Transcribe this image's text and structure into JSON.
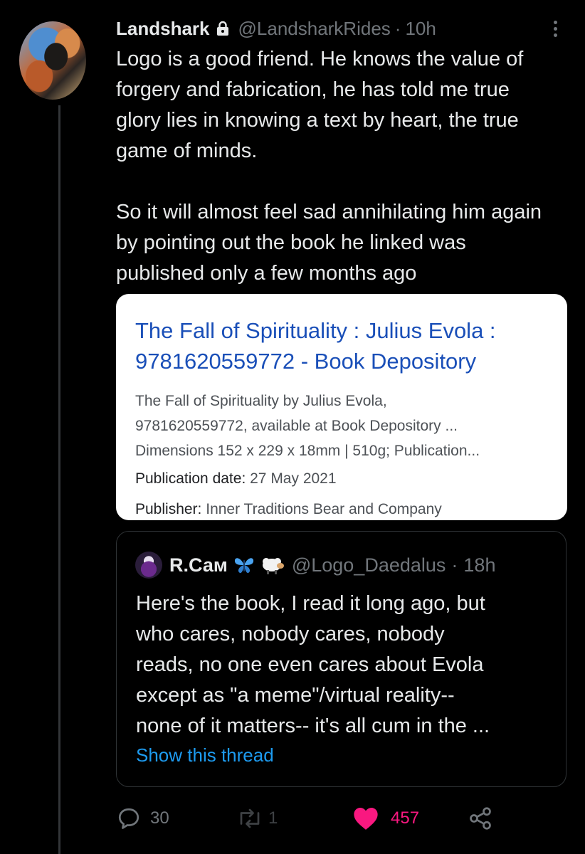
{
  "tweet": {
    "author_name": "Landshark",
    "author_handle": "@LandsharkRides",
    "separator": "·",
    "time": "10h",
    "paragraphs": [
      "Logo is a good friend. He knows the value of forgery and fabrication, he has told me true glory lies in knowing a text by heart, the true game of minds.",
      "So it will almost feel sad annihilating him again by pointing out the book he linked was published only a few months ago"
    ]
  },
  "link_card": {
    "title_line1": "The Fall of Spirituality : Julius Evola :",
    "title_line2": "9781620559772 - Book Depository",
    "snippet_line1": "The Fall of Spirituality by Julius Evola,",
    "snippet_line2": "9781620559772, available at Book Depository ...",
    "snippet_line3": "Dimensions 152 x 229 x 18mm | 510g; Publication...",
    "pub_date_label": "Publication date:",
    "pub_date_value": "27 May 2021",
    "publisher_label": "Publisher:",
    "publisher_value": "Inner Traditions Bear and Company"
  },
  "quoted_tweet": {
    "author_name": "R.Сам",
    "author_handle": "@Logo_Daedalus",
    "separator": "·",
    "time": "18h",
    "lines": [
      "Here's the book, I read it long ago, but",
      "who cares, nobody cares, nobody",
      "reads, no one even cares about Evola",
      "except as \"a meme\"/virtual reality--",
      "none of it matters-- it's all cum in the ..."
    ],
    "show_thread": "Show this thread"
  },
  "actions": {
    "reply_count": "30",
    "retweet_count": "1",
    "like_count": "457"
  },
  "colors": {
    "background": "#000000",
    "text": "#e7e9ea",
    "muted": "#71767b",
    "link_blue": "#1d9bf0",
    "like_red": "#f91880",
    "card_title_blue": "#1a4fb8"
  },
  "icons": [
    "lock-icon",
    "more-icon",
    "butterfly-icon",
    "sheep-icon",
    "reply-icon",
    "retweet-icon",
    "like-icon",
    "share-icon"
  ]
}
